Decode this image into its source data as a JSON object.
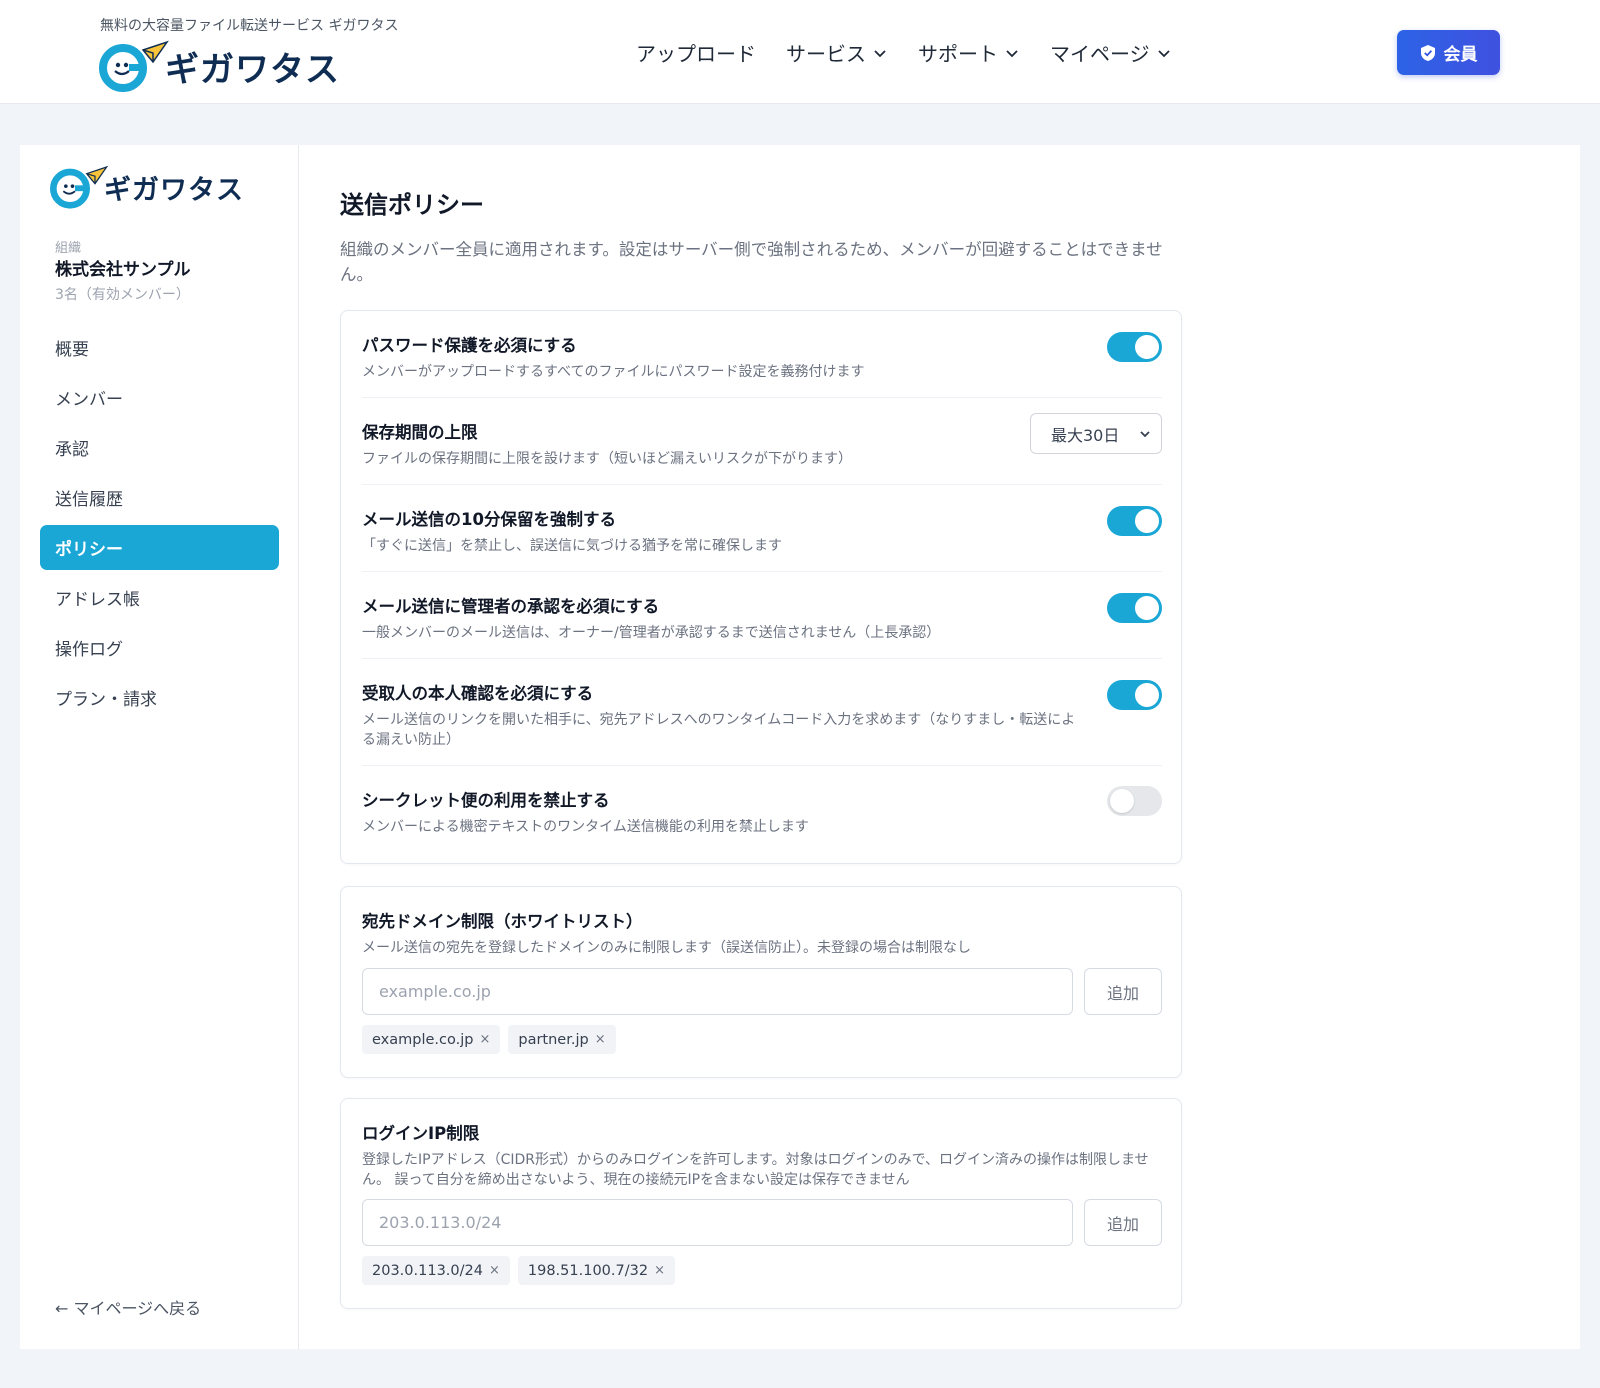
{
  "header": {
    "tagline": "無料の大容量ファイル転送サービス ギガワタス",
    "brand": "ギガワタス",
    "nav": [
      {
        "label": "アップロード"
      },
      {
        "label": "サービス"
      },
      {
        "label": "サポート"
      },
      {
        "label": "マイページ"
      }
    ],
    "member_button": "会員"
  },
  "sidebar": {
    "brand": "ギガワタス",
    "org_label": "組織",
    "org_name": "株式会社サンプル",
    "org_count": "3名（有効メンバー）",
    "items": [
      {
        "label": "概要"
      },
      {
        "label": "メンバー"
      },
      {
        "label": "承認"
      },
      {
        "label": "送信履歴"
      },
      {
        "label": "ポリシー"
      },
      {
        "label": "アドレス帳"
      },
      {
        "label": "操作ログ"
      },
      {
        "label": "プラン・請求"
      }
    ],
    "active_item": "ポリシー",
    "back_link": "← マイページへ戻る"
  },
  "main": {
    "title": "送信ポリシー",
    "description": "組織のメンバー全員に適用されます。設定はサーバー側で強制されるため、メンバーが回避することはできません。",
    "policies": [
      {
        "title": "パスワード保護を必須にする",
        "desc": "メンバーがアップロードするすべてのファイルにパスワード設定を義務付けます",
        "enabled": true
      },
      {
        "title": "保存期間の上限",
        "desc": "ファイルの保存期間に上限を設けます（短いほど漏えいリスクが下がります）",
        "select_value": "最大30日"
      },
      {
        "title": "メール送信の10分保留を強制する",
        "desc": "「すぐに送信」を禁止し、誤送信に気づける猶予を常に確保します",
        "enabled": true
      },
      {
        "title": "メール送信に管理者の承認を必須にする",
        "desc": "一般メンバーのメール送信は、オーナー/管理者が承認するまで送信されません（上長承認）",
        "enabled": true
      },
      {
        "title": "受取人の本人確認を必須にする",
        "desc": "メール送信のリンクを開いた相手に、宛先アドレスへのワンタイムコード入力を求めます（なりすまし・転送による漏えい防止）",
        "enabled": true
      },
      {
        "title": "シークレット便の利用を禁止する",
        "desc": "メンバーによる機密テキストのワンタイム送信機能の利用を禁止します",
        "enabled": false
      }
    ],
    "domain_restriction": {
      "title": "宛先ドメイン制限（ホワイトリスト）",
      "desc": "メール送信の宛先を登録したドメインのみに制限します（誤送信防止）。未登録の場合は制限なし",
      "placeholder": "example.co.jp",
      "add_label": "追加",
      "entries": [
        "example.co.jp",
        "partner.jp"
      ]
    },
    "ip_restriction": {
      "title": "ログインIP制限",
      "desc": "登録したIPアドレス（CIDR形式）からのみログインを許可します。対象はログインのみで、ログイン済みの操作は制限しません。 誤って自分を締め出さないよう、現在の接続元IPを含まない設定は保存できません",
      "placeholder": "203.0.113.0/24",
      "add_label": "追加",
      "entries": [
        "203.0.113.0/24",
        "198.51.100.7/32"
      ]
    },
    "chip_remove": "×"
  },
  "colors": {
    "accent": "#1aa7d6",
    "member_button": "#3355e3",
    "brand_navy": "#0f2d52"
  }
}
